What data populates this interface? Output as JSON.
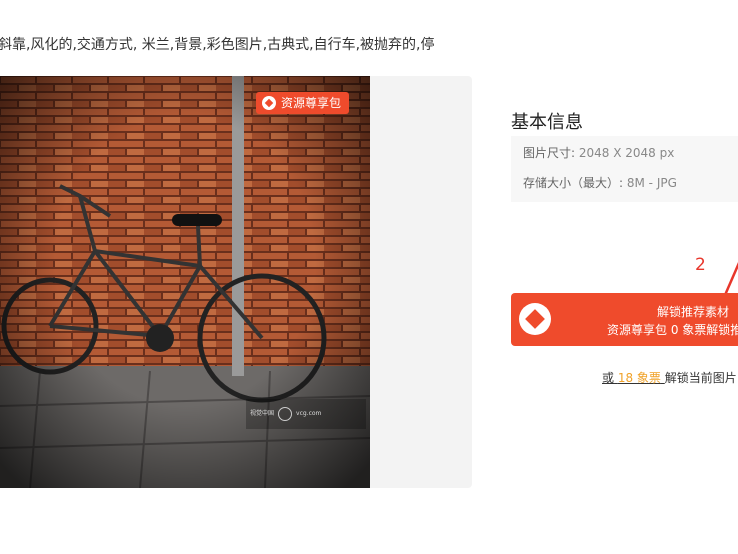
{
  "tags_line": "斜靠,风化的,交通方式, 米兰,背景,彩色图片,古典式,自行车,被抛弃的,停",
  "preview": {
    "badge_label": "资源尊享包",
    "watermark_brand": "视觉中国",
    "watermark_text": "vcg.com"
  },
  "info": {
    "title": "基本信息",
    "size_label": "图片尺寸:",
    "size_value": "2048 X 2048 px",
    "storage_label": "存储大小（最大）:",
    "storage_value": "8M - JPG"
  },
  "annotation": {
    "number": "2",
    "color": "#e8362b"
  },
  "unlock_button": {
    "line1": "解锁推荐素材",
    "line2": "资源尊享包 0 象票解锁推"
  },
  "alt": {
    "prefix": "或",
    "points": "18 象票",
    "suffix": "解锁当前图片"
  },
  "colors": {
    "accent": "#ef4b2c",
    "points": "#f0a229"
  }
}
